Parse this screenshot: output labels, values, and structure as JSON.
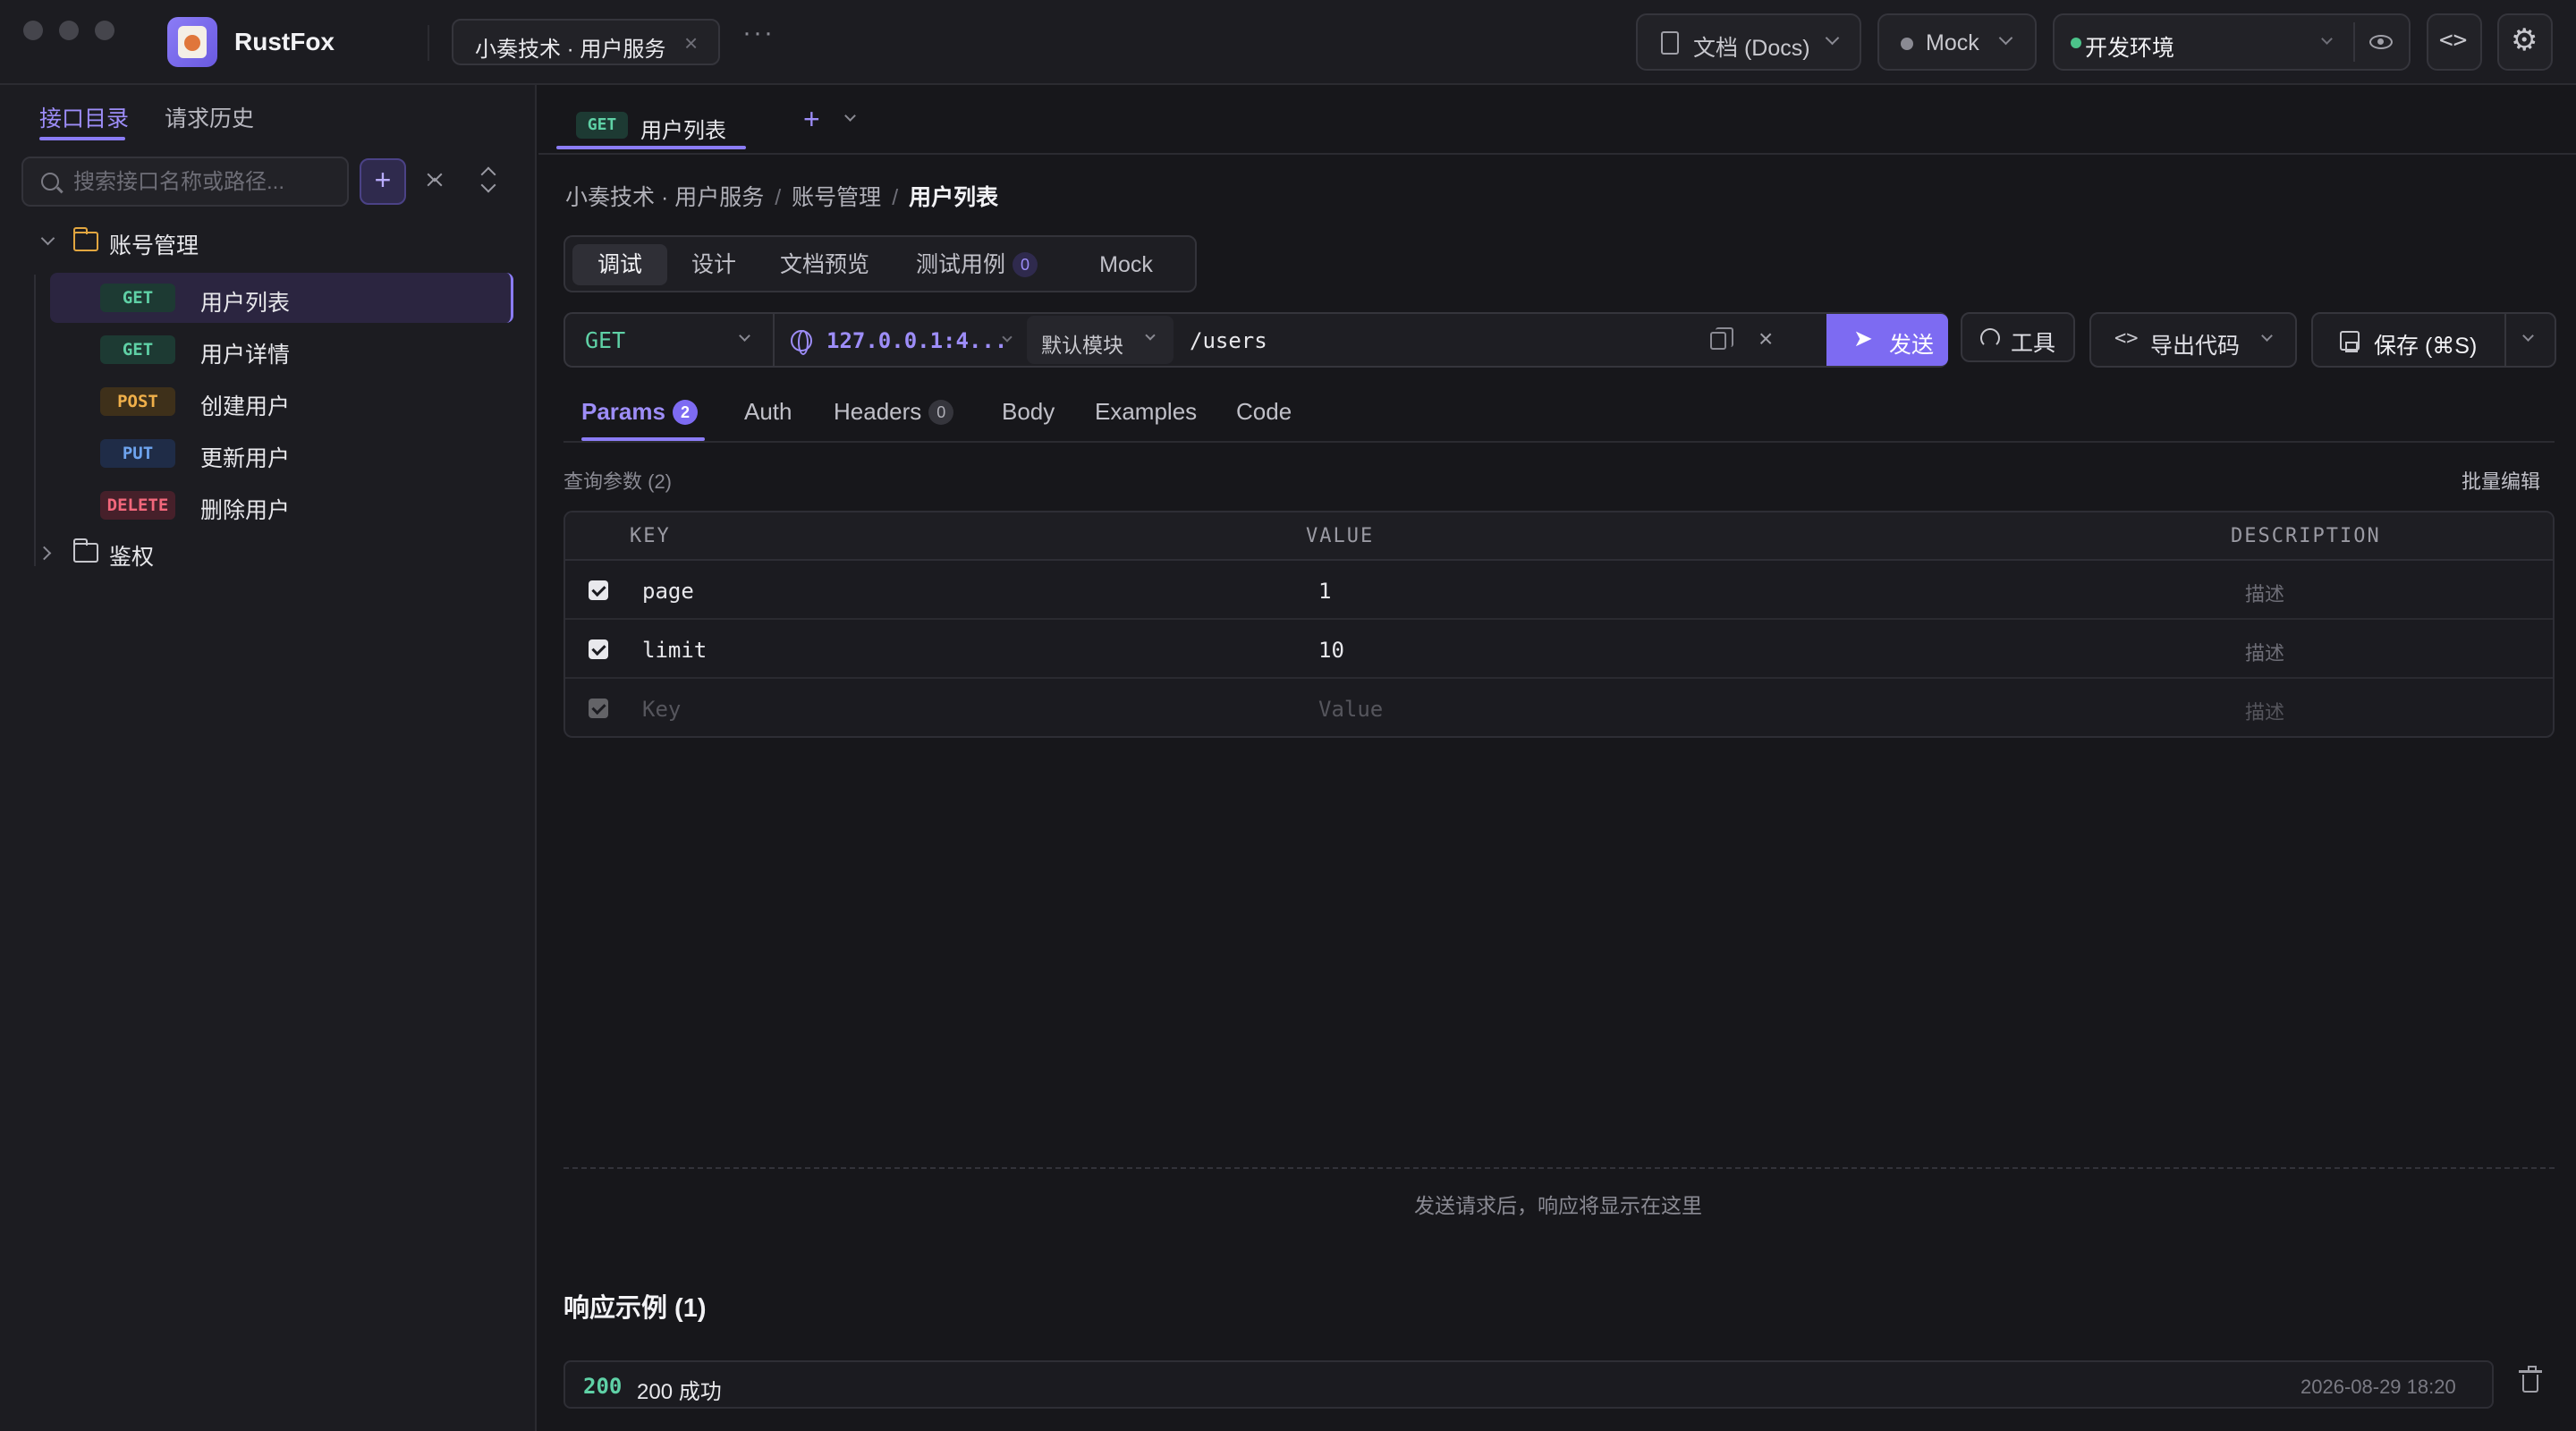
{
  "app": {
    "name": "RustFox"
  },
  "titlebar": {
    "project_chip": "小奏技术 · 用户服务",
    "more": "···",
    "docs_button": "文档 (Docs)",
    "mock_button": "Mock",
    "environment": "开发环境",
    "env_color": "#4cc38a"
  },
  "sidebar": {
    "tabs": [
      {
        "label": "接口目录",
        "active": true
      },
      {
        "label": "请求历史",
        "active": false
      }
    ],
    "search_placeholder": "搜索接口名称或路径...",
    "add_icon": "+",
    "folders": [
      {
        "name": "账号管理",
        "expanded": true,
        "items": [
          {
            "method": "GET",
            "label": "用户列表",
            "active": true
          },
          {
            "method": "GET",
            "label": "用户详情",
            "active": false
          },
          {
            "method": "POST",
            "label": "创建用户",
            "active": false
          },
          {
            "method": "PUT",
            "label": "更新用户",
            "active": false
          },
          {
            "method": "DELETE",
            "label": "删除用户",
            "active": false
          }
        ]
      },
      {
        "name": "鉴权",
        "expanded": false
      }
    ]
  },
  "doc_tabs": [
    {
      "method": "GET",
      "label": "用户列表",
      "active": true
    }
  ],
  "breadcrumb": [
    "小奏技术 · 用户服务",
    "账号管理",
    "用户列表"
  ],
  "mode_tabs": [
    {
      "label": "调试",
      "active": true
    },
    {
      "label": "设计",
      "active": false
    },
    {
      "label": "文档预览",
      "active": false
    },
    {
      "label": "测试用例",
      "active": false,
      "count": "0"
    },
    {
      "label": "Mock",
      "active": false
    }
  ],
  "request": {
    "method": "GET",
    "host": "127.0.0.1:4...",
    "module": "默认模块",
    "path": "/users",
    "send_label": "发送",
    "tools_label": "工具",
    "export_label": "导出代码",
    "save_label": "保存 (⌘S)"
  },
  "param_tabs": [
    {
      "label": "Params",
      "active": true,
      "count": "2"
    },
    {
      "label": "Auth",
      "active": false
    },
    {
      "label": "Headers",
      "active": false,
      "count": "0"
    },
    {
      "label": "Body",
      "active": false
    },
    {
      "label": "Examples",
      "active": false
    },
    {
      "label": "Code",
      "active": false
    }
  ],
  "query_params": {
    "label": "查询参数 (2)",
    "bulk_edit": "批量编辑",
    "columns": [
      "KEY",
      "VALUE",
      "DESCRIPTION"
    ],
    "rows": [
      {
        "checked": true,
        "key": "page",
        "value": "1",
        "description": "描述"
      },
      {
        "checked": true,
        "key": "limit",
        "value": "10",
        "description": "描述"
      }
    ],
    "placeholder_row": {
      "key": "Key",
      "value": "Value",
      "description": "描述"
    }
  },
  "response": {
    "hint": "发送请求后，响应将显示在这里",
    "examples_title": "响应示例 (1)",
    "examples": [
      {
        "code": "200",
        "name": "200 成功",
        "time": "2026-08-29 18:20"
      }
    ]
  },
  "colors": {
    "accent": "#7d6bf2",
    "get": "#5fd1a6",
    "post": "#f0b04a",
    "put": "#6ea4ef",
    "delete": "#f2677b"
  }
}
